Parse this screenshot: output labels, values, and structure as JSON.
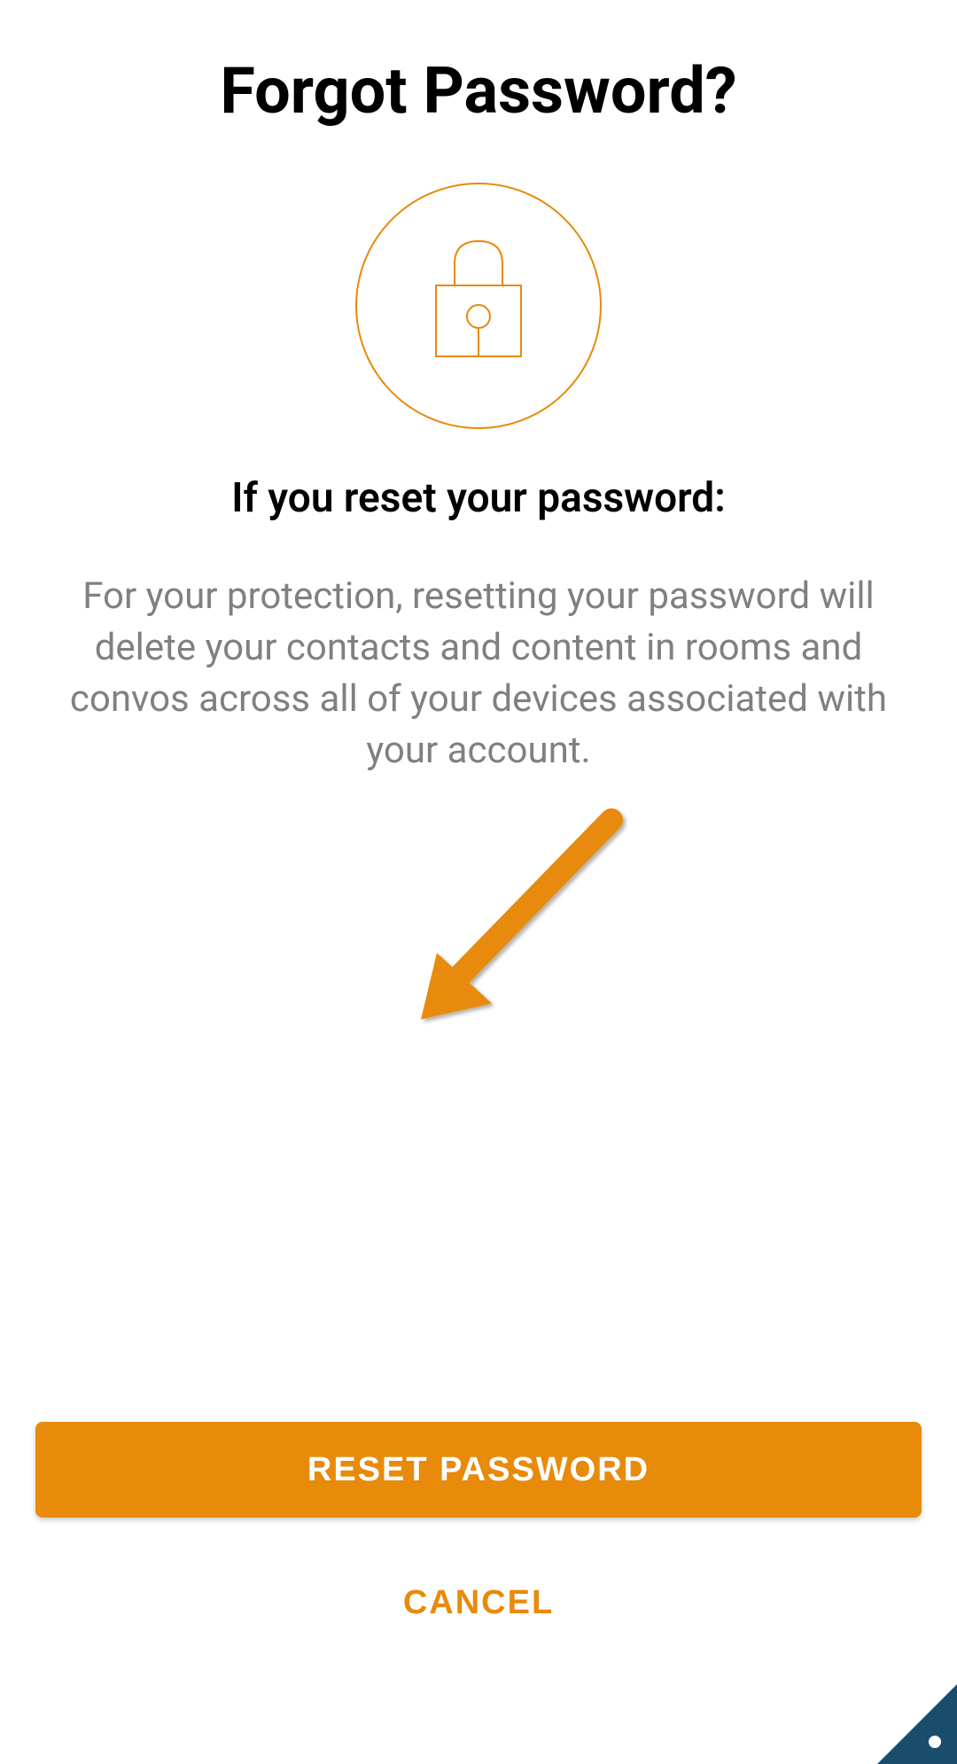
{
  "title": "Forgot Password?",
  "subtitle": "If you reset your password:",
  "description": "For your protection, resetting your password will delete your contacts and content in rooms and convos across all of your devices associated with your account.",
  "buttons": {
    "reset_label": "RESET PASSWORD",
    "cancel_label": "CANCEL"
  },
  "colors": {
    "accent": "#e88a0a",
    "corner": "#1a4d6d"
  }
}
